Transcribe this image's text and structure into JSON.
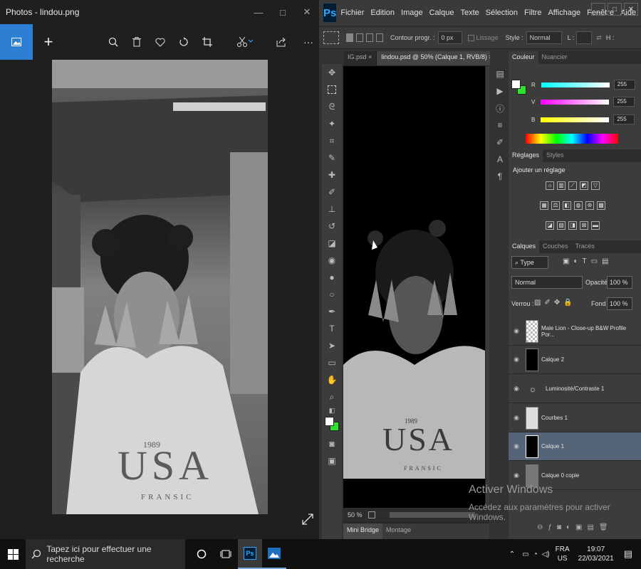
{
  "photos": {
    "title": "Photos - lindou.png",
    "window_controls": [
      "—",
      "□",
      "✕"
    ],
    "toolbar": [
      "zoom-icon",
      "delete-icon",
      "favorite-icon",
      "rotate-icon",
      "crop-icon",
      "edit-icon",
      "share-icon",
      "more-icon"
    ],
    "more_label": "···",
    "add_label": "+"
  },
  "ps": {
    "logo": "Ps",
    "menus": [
      "Fichier",
      "Edition",
      "Image",
      "Calque",
      "Texte",
      "Sélection",
      "Filtre",
      "Affichage",
      "Fenêtre",
      "Aide"
    ],
    "window_controls": [
      "_",
      "□",
      "✕"
    ],
    "options": {
      "contour_label": "Contour progr. :",
      "contour_value": "0 px",
      "lissage": "Lissage",
      "style_label": "Style :",
      "style_value": "Normal",
      "l_label": "L :",
      "h_label": "H :"
    },
    "tabs": [
      {
        "label": "IG.psd",
        "close": "×"
      },
      {
        "label": "lindou.psd @ 50% (Calque 1, RVB/8)",
        "close": "×"
      }
    ],
    "zoom": "50 %",
    "bottom_tabs": [
      "Mini Bridge",
      "Montage"
    ],
    "color_panel": {
      "tabs": [
        "Couleur",
        "Nuancier"
      ],
      "sliders": [
        {
          "label": "R",
          "value": "255"
        },
        {
          "label": "V",
          "value": "255"
        },
        {
          "label": "B",
          "value": "255"
        }
      ]
    },
    "adjust_panel": {
      "tabs": [
        "Réglages",
        "Styles"
      ],
      "heading": "Ajouter un réglage"
    },
    "layers_panel": {
      "tabs": [
        "Calques",
        "Couches",
        "Tracés"
      ],
      "filter": "Type",
      "blend_mode": "Normal",
      "opacity_label": "Opacité :",
      "opacity_value": "100 %",
      "lock_label": "Verrou :",
      "fill_label": "Fond :",
      "fill_value": "100 %",
      "layers": [
        {
          "name": "Male Lion - Close-up B&W Profile Por...",
          "selected": false
        },
        {
          "name": "Calque 2",
          "selected": false
        },
        {
          "name": "Luminosité/Contraste 1",
          "selected": false
        },
        {
          "name": "Courbes 1",
          "selected": false
        },
        {
          "name": "Calque 1",
          "selected": true
        },
        {
          "name": "Calque 0 copie",
          "selected": false
        }
      ]
    },
    "activation": {
      "title": "Activer Windows",
      "subtitle": "Accédez aux paramètres pour activer Windows."
    }
  },
  "taskbar": {
    "search_placeholder": "Tapez ici pour effectuer une recherche",
    "lang": "FRA",
    "region": "US",
    "time": "19:07",
    "date": "22/03/2021"
  },
  "poster": {
    "big": "USA",
    "year": "1989",
    "small": "FRANSIC"
  },
  "colors": {
    "photos_accent": "#2d7fd3",
    "ps_blue": "#31a8ff",
    "selected_layer": "#556477"
  }
}
